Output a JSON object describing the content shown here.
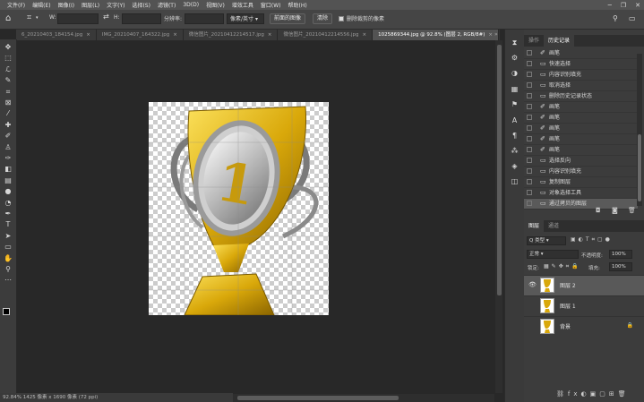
{
  "menu": [
    "文件(F)",
    "编辑(E)",
    "图像(I)",
    "图层(L)",
    "文字(Y)",
    "选择(S)",
    "滤镜(T)",
    "3D(D)",
    "视图(V)",
    "增效工具",
    "窗口(W)",
    "帮助(H)"
  ],
  "window_controls": {
    "minimize": "─",
    "restore": "❐",
    "close": "✕"
  },
  "options_bar": {
    "w_label": "W:",
    "link_glyph": "⇄",
    "h_label": "H:",
    "resolution_label": "分辨率:",
    "resolution_unit": "像素/英寸",
    "preset_button": "前面的图像",
    "clear_button": "清除",
    "crop_checkbox_label": "删除裁剪的像素"
  },
  "tabs": [
    {
      "label": "6_20210403_184154.jpg",
      "active": false
    },
    {
      "label": "IMG_20210407_164322.jpg",
      "active": false
    },
    {
      "label": "微信图片_20210412214517.jpg",
      "active": false
    },
    {
      "label": "微信图片_20210412214556.jpg",
      "active": false
    },
    {
      "label": "1025869344.jpg @ 92.8% (图层 2, RGB/8#)",
      "active": true
    }
  ],
  "tools": [
    {
      "icon": "move-icon",
      "glyph": "✥"
    },
    {
      "icon": "marquee-icon",
      "glyph": "⬚"
    },
    {
      "icon": "lasso-icon",
      "glyph": "ℒ"
    },
    {
      "icon": "quick-select-icon",
      "glyph": "✎"
    },
    {
      "icon": "crop-icon",
      "glyph": "⌗"
    },
    {
      "icon": "frame-icon",
      "glyph": "⊠"
    },
    {
      "icon": "eyedropper-icon",
      "glyph": "⁄"
    },
    {
      "icon": "healing-icon",
      "glyph": "✚"
    },
    {
      "icon": "brush-icon",
      "glyph": "✐"
    },
    {
      "icon": "stamp-icon",
      "glyph": "♙"
    },
    {
      "icon": "history-brush-icon",
      "glyph": "✑"
    },
    {
      "icon": "eraser-icon",
      "glyph": "◧"
    },
    {
      "icon": "gradient-icon",
      "glyph": "▤"
    },
    {
      "icon": "blur-icon",
      "glyph": "●"
    },
    {
      "icon": "dodge-icon",
      "glyph": "◔"
    },
    {
      "icon": "pen-icon",
      "glyph": "✒"
    },
    {
      "icon": "type-icon",
      "glyph": "T"
    },
    {
      "icon": "path-select-icon",
      "glyph": "➤"
    },
    {
      "icon": "shape-icon",
      "glyph": "▭"
    },
    {
      "icon": "hand-icon",
      "glyph": "✋"
    },
    {
      "icon": "zoom-icon",
      "glyph": "⚲"
    },
    {
      "icon": "more-icon",
      "glyph": "⋯"
    }
  ],
  "status_bar": "92.84%    1425 像素 x 1690 像素 (72 ppi)",
  "mid_icons": [
    {
      "icon": "history-panel-icon",
      "glyph": "⧗"
    },
    {
      "icon": "adjust-icon",
      "glyph": "⚙"
    },
    {
      "icon": "color-icon",
      "glyph": "◑"
    },
    {
      "icon": "swatch-icon",
      "glyph": "▦"
    },
    {
      "icon": "brush-settings-icon",
      "glyph": "⚑"
    },
    {
      "icon": "character-icon",
      "glyph": "A"
    },
    {
      "icon": "paragraph-icon",
      "glyph": "¶"
    },
    {
      "icon": "glyph-icon",
      "glyph": "⁂"
    },
    {
      "icon": "cube-icon",
      "glyph": "◈"
    },
    {
      "icon": "layer-comp-icon",
      "glyph": "◫"
    }
  ],
  "history": {
    "tabs": [
      "操作",
      "历史记录"
    ],
    "items": [
      {
        "icon": "brush",
        "label": "画笔",
        "selected": false
      },
      {
        "icon": "select",
        "label": "快速选择",
        "selected": false
      },
      {
        "icon": "select",
        "label": "内容识别填充",
        "selected": false
      },
      {
        "icon": "select",
        "label": "取消选择",
        "selected": false
      },
      {
        "icon": "select",
        "label": "删除历史记录状态",
        "selected": false
      },
      {
        "icon": "brush",
        "label": "画笔",
        "selected": false
      },
      {
        "icon": "brush",
        "label": "画笔",
        "selected": false
      },
      {
        "icon": "brush",
        "label": "画笔",
        "selected": false
      },
      {
        "icon": "brush",
        "label": "画笔",
        "selected": false
      },
      {
        "icon": "brush",
        "label": "画笔",
        "selected": false
      },
      {
        "icon": "select",
        "label": "选择反向",
        "selected": false
      },
      {
        "icon": "select",
        "label": "内容识别填充",
        "selected": false
      },
      {
        "icon": "select",
        "label": "复制图层",
        "selected": false
      },
      {
        "icon": "select",
        "label": "对象选择工具",
        "selected": false
      },
      {
        "icon": "select",
        "label": "通过拷贝的图层",
        "selected": true
      }
    ]
  },
  "layers": {
    "tabs": [
      "图层",
      "通道"
    ],
    "filter_label": "Q 类型",
    "blend_mode": "正常",
    "opacity_label": "不透明度:",
    "opacity_value": "100%",
    "lock_label": "锁定:",
    "fill_label": "填充:",
    "fill_value": "100%",
    "items": [
      {
        "name": "图层 2",
        "visible": true,
        "selected": true,
        "locked": false
      },
      {
        "name": "图层 1",
        "visible": false,
        "selected": false,
        "locked": false
      },
      {
        "name": "背景",
        "visible": false,
        "selected": false,
        "locked": true
      }
    ]
  },
  "colors": {
    "ui_dark": "#282828",
    "panel": "#3c3c3c",
    "gold": "#d9a80a"
  }
}
